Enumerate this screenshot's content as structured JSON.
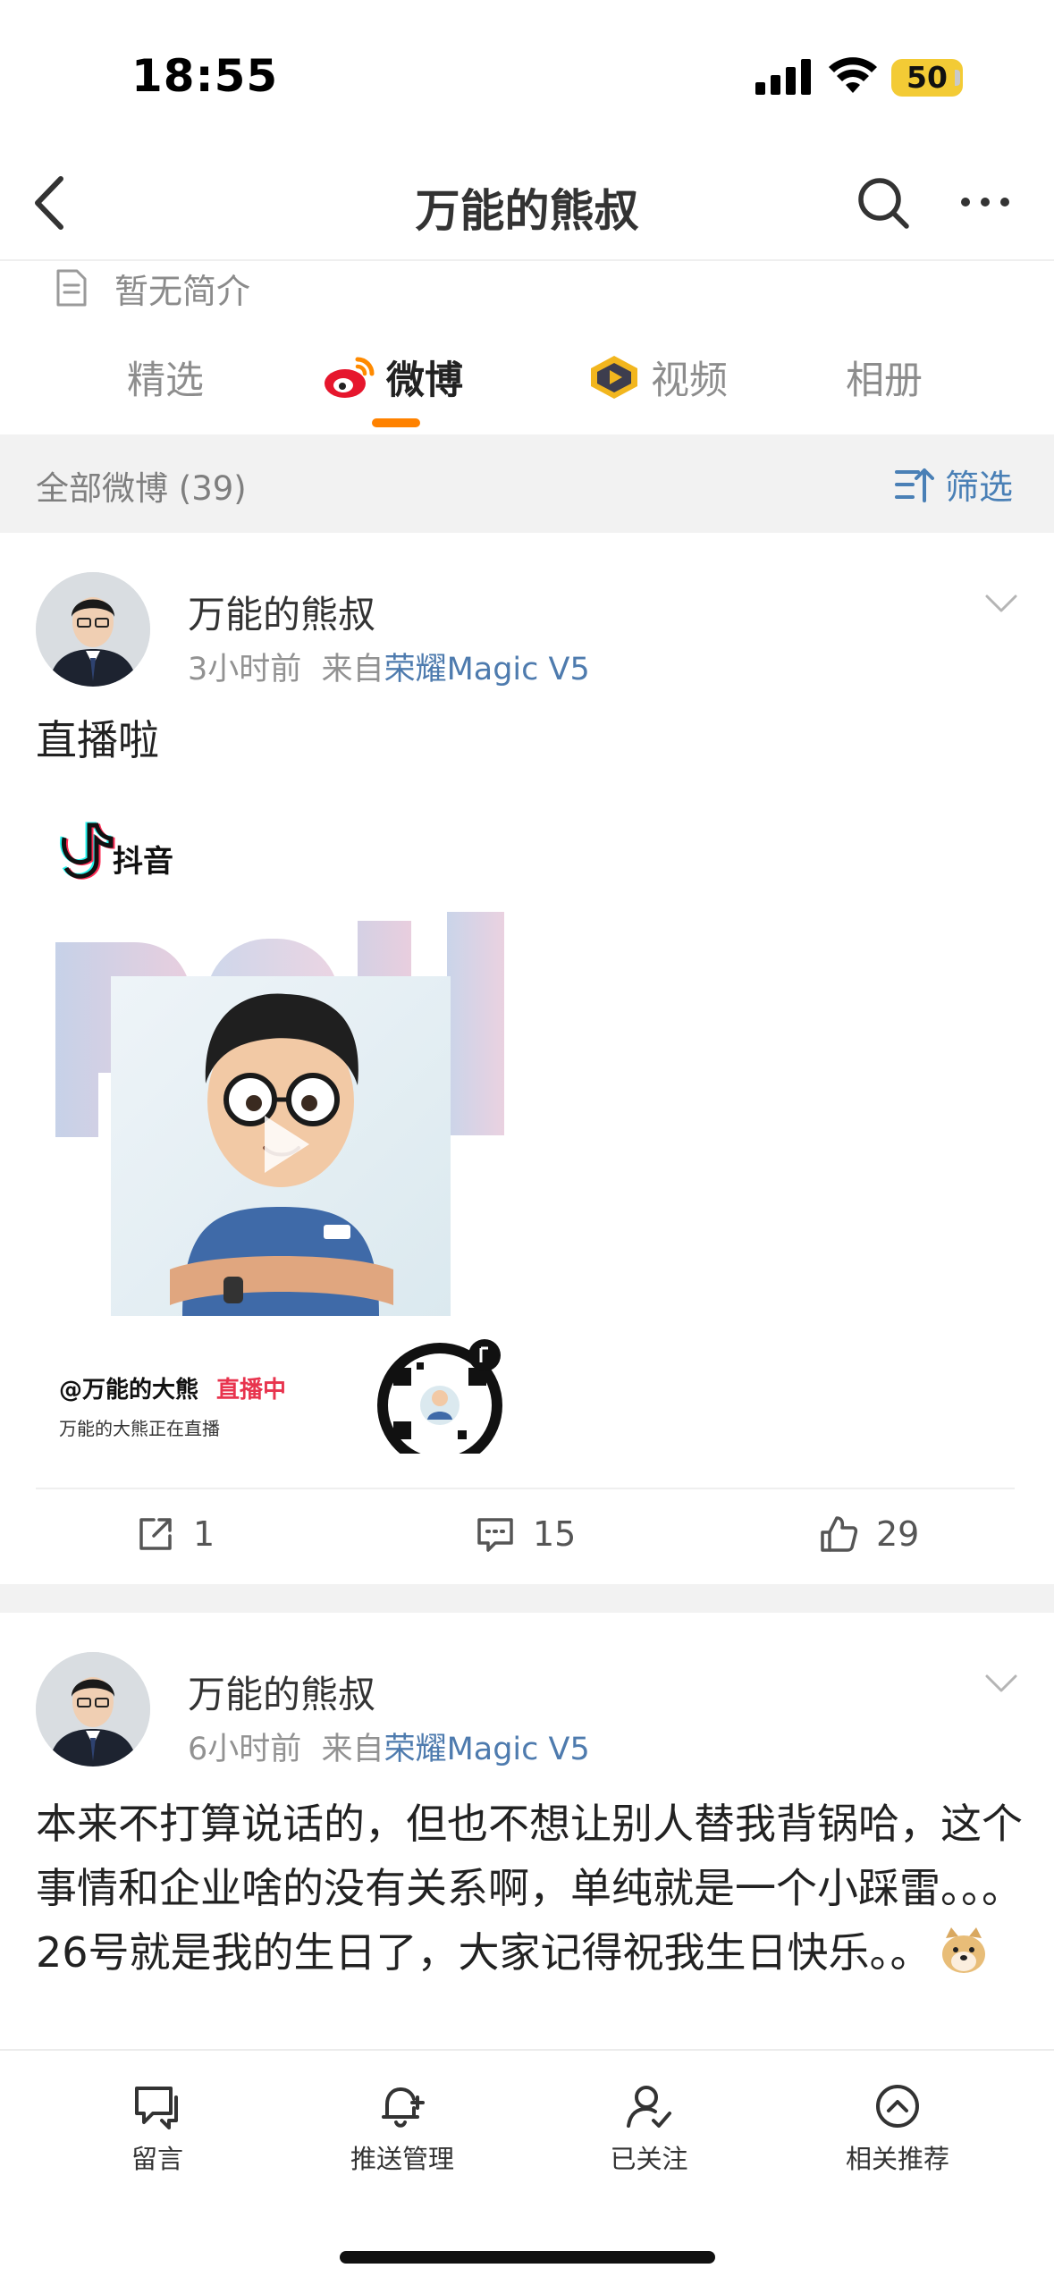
{
  "status": {
    "time": "18:55",
    "battery": "50"
  },
  "nav": {
    "title": "万能的熊叔"
  },
  "bio": {
    "text": "暂无简介"
  },
  "tabs": [
    {
      "label": "精选"
    },
    {
      "label": "微博"
    },
    {
      "label": "视频"
    },
    {
      "label": "相册"
    }
  ],
  "filter": {
    "count_label": "全部微博 (39)",
    "button_label": "筛选"
  },
  "posts": [
    {
      "author": "万能的熊叔",
      "time": "3小时前",
      "from_prefix": "来自",
      "source": "荣耀Magic V5",
      "text": "直播啦",
      "media": {
        "app": "抖音",
        "handle": "@万能的大熊",
        "live_badge": "直播中",
        "subtitle": "万能的大熊正在直播"
      },
      "reposts": "1",
      "comments": "15",
      "likes": "29"
    },
    {
      "author": "万能的熊叔",
      "time": "6小时前",
      "from_prefix": "来自",
      "source": "荣耀Magic V5",
      "text": "本来不打算说话的，但也不想让别人替我背锅哈，这个事情和企业啥的没有关系啊，单纯就是一个小踩雷。。。26号就是我的生日了，大家记得祝我生日快乐。。"
    }
  ],
  "bottom_bar": [
    {
      "label": "留言",
      "icon": "message-icon"
    },
    {
      "label": "推送管理",
      "icon": "bell-icon"
    },
    {
      "label": "已关注",
      "icon": "followed-user-icon"
    },
    {
      "label": "相关推荐",
      "icon": "recommend-icon"
    }
  ],
  "colors": {
    "accent": "#ff8200",
    "link": "#4e7bae",
    "live": "#e8344e",
    "battery": "#f3cb35"
  }
}
